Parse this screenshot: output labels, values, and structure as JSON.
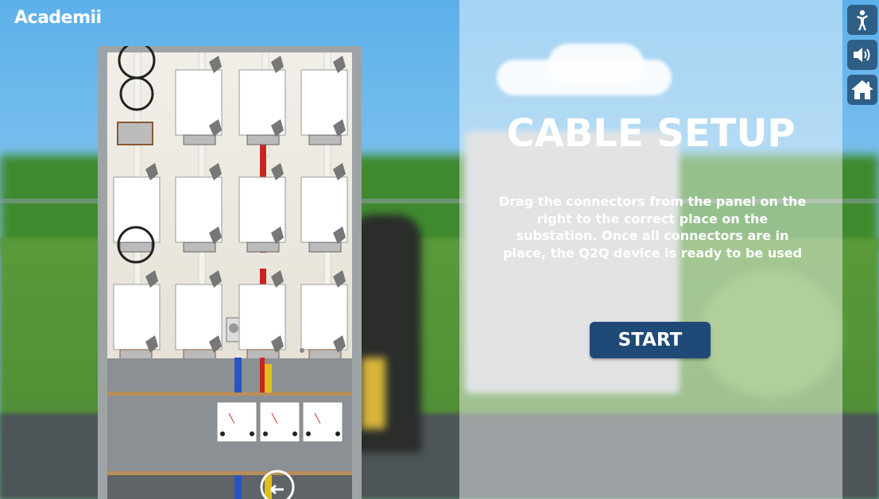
{
  "brand": {
    "logo_text": "Academii"
  },
  "intro": {
    "title": "CABLE SETUP",
    "description": "Drag the connectors from the panel on the right to the correct place on the substation. Once all connectors are in place, the Q2Q device is ready to be used",
    "start_label": "START"
  },
  "toolbar": {
    "items": [
      {
        "name": "accessibility",
        "icon": "accessibility-icon"
      },
      {
        "name": "sound",
        "icon": "speaker-icon"
      },
      {
        "name": "home",
        "icon": "home-icon"
      }
    ]
  },
  "colors": {
    "start_button": "#1f4a77",
    "toolbar_button": "#2f5f86",
    "cable_red": "#c8261e",
    "cable_blue": "#2a54c4",
    "cable_yellow": "#e0c020"
  }
}
